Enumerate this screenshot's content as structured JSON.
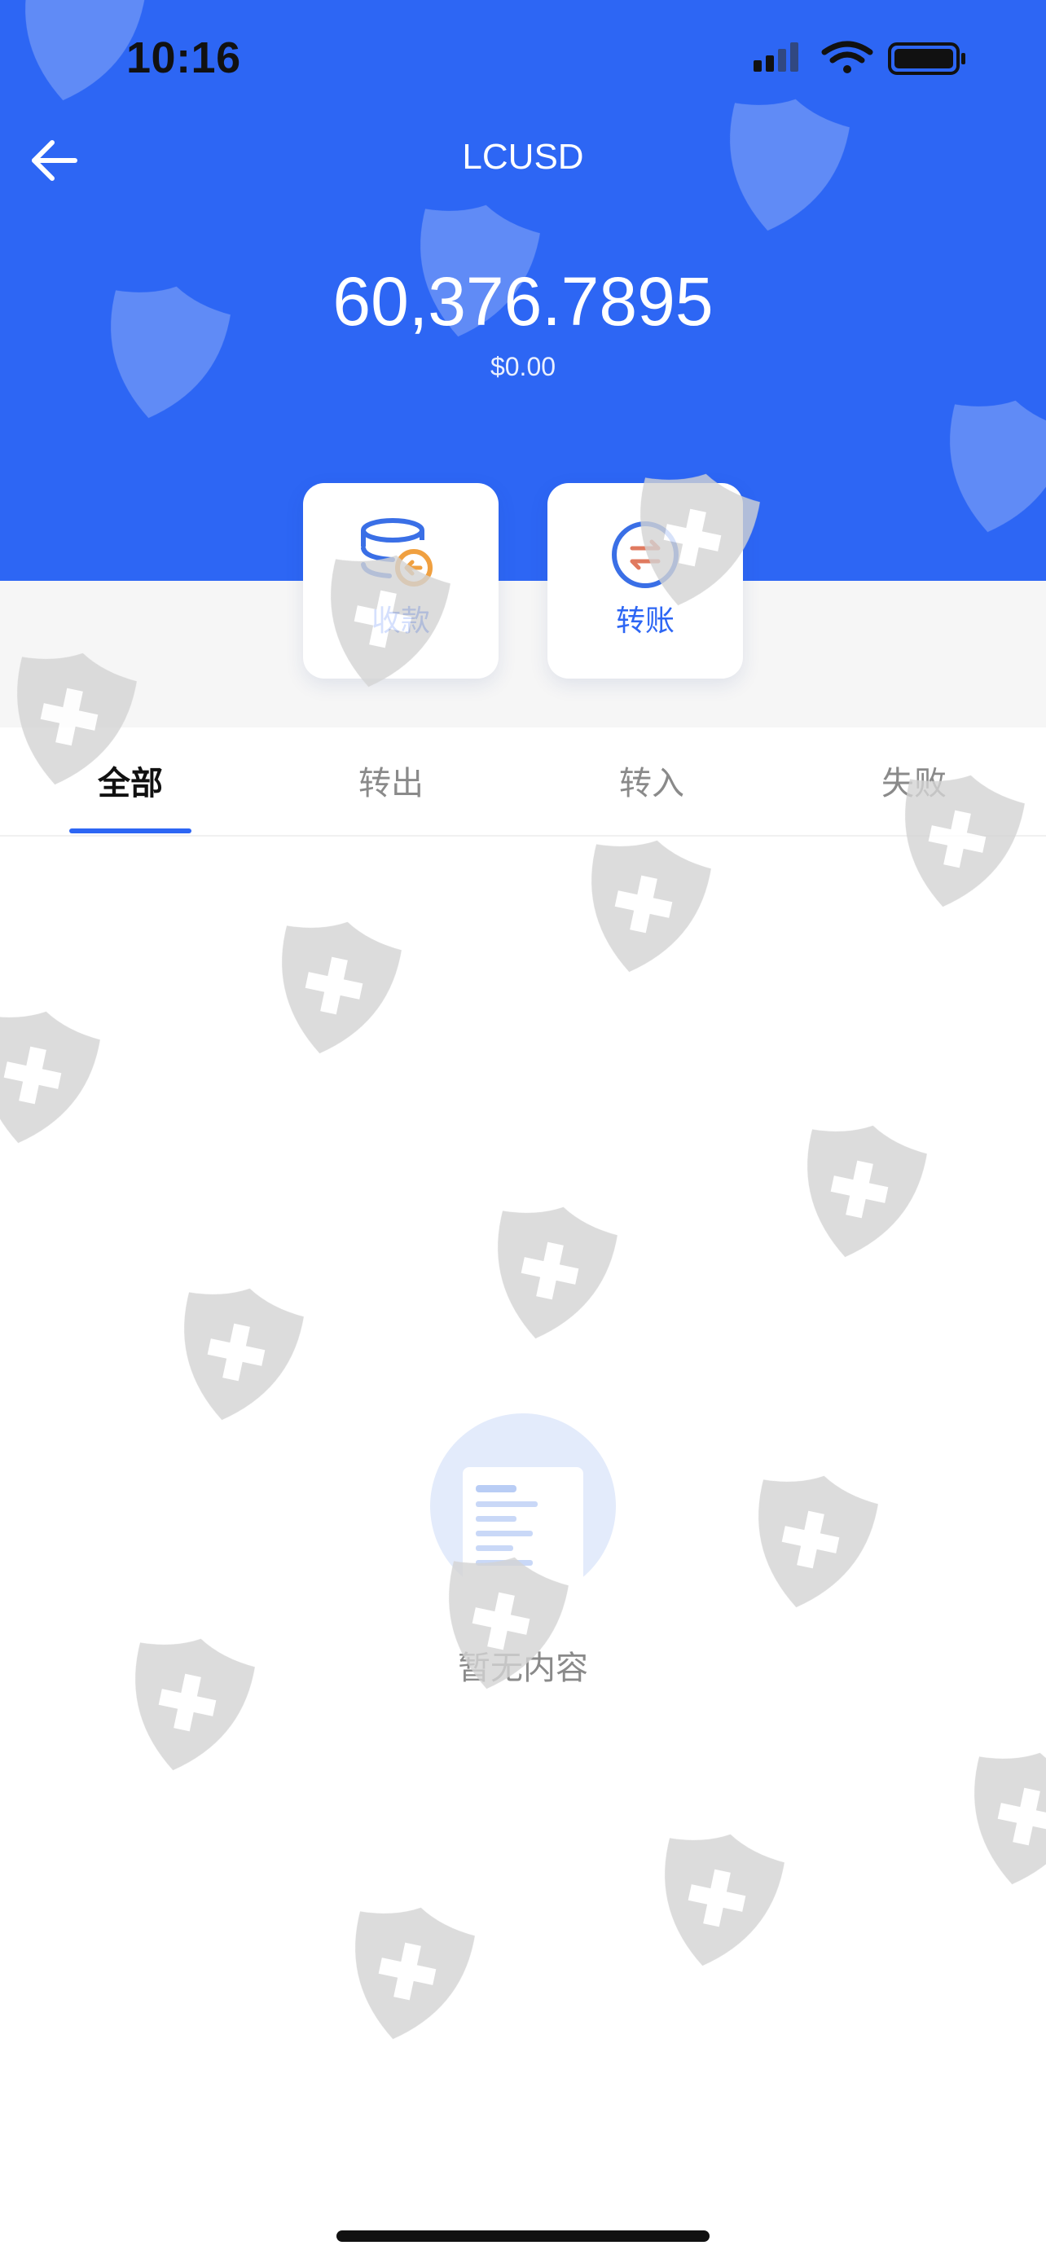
{
  "status_bar": {
    "time": "10:16"
  },
  "header": {
    "title": "LCUSD",
    "balance": "60,376.7895",
    "balance_usd": "$0.00",
    "background_color": "#2d66f4"
  },
  "actions": [
    {
      "label": "收款",
      "icon": "coin-stack-receive-icon"
    },
    {
      "label": "转账",
      "icon": "transfer-arrows-icon"
    }
  ],
  "tabs": [
    {
      "label": "全部",
      "active": true
    },
    {
      "label": "转出",
      "active": false
    },
    {
      "label": "转入",
      "active": false
    },
    {
      "label": "失败",
      "active": false
    }
  ],
  "empty_state": {
    "text": "暂无内容",
    "icon": "empty-document-icon"
  },
  "colors": {
    "accent": "#2d66f4",
    "receive_icon_orange": "#f0a040",
    "transfer_icon_arrows": "#e07a5f"
  }
}
